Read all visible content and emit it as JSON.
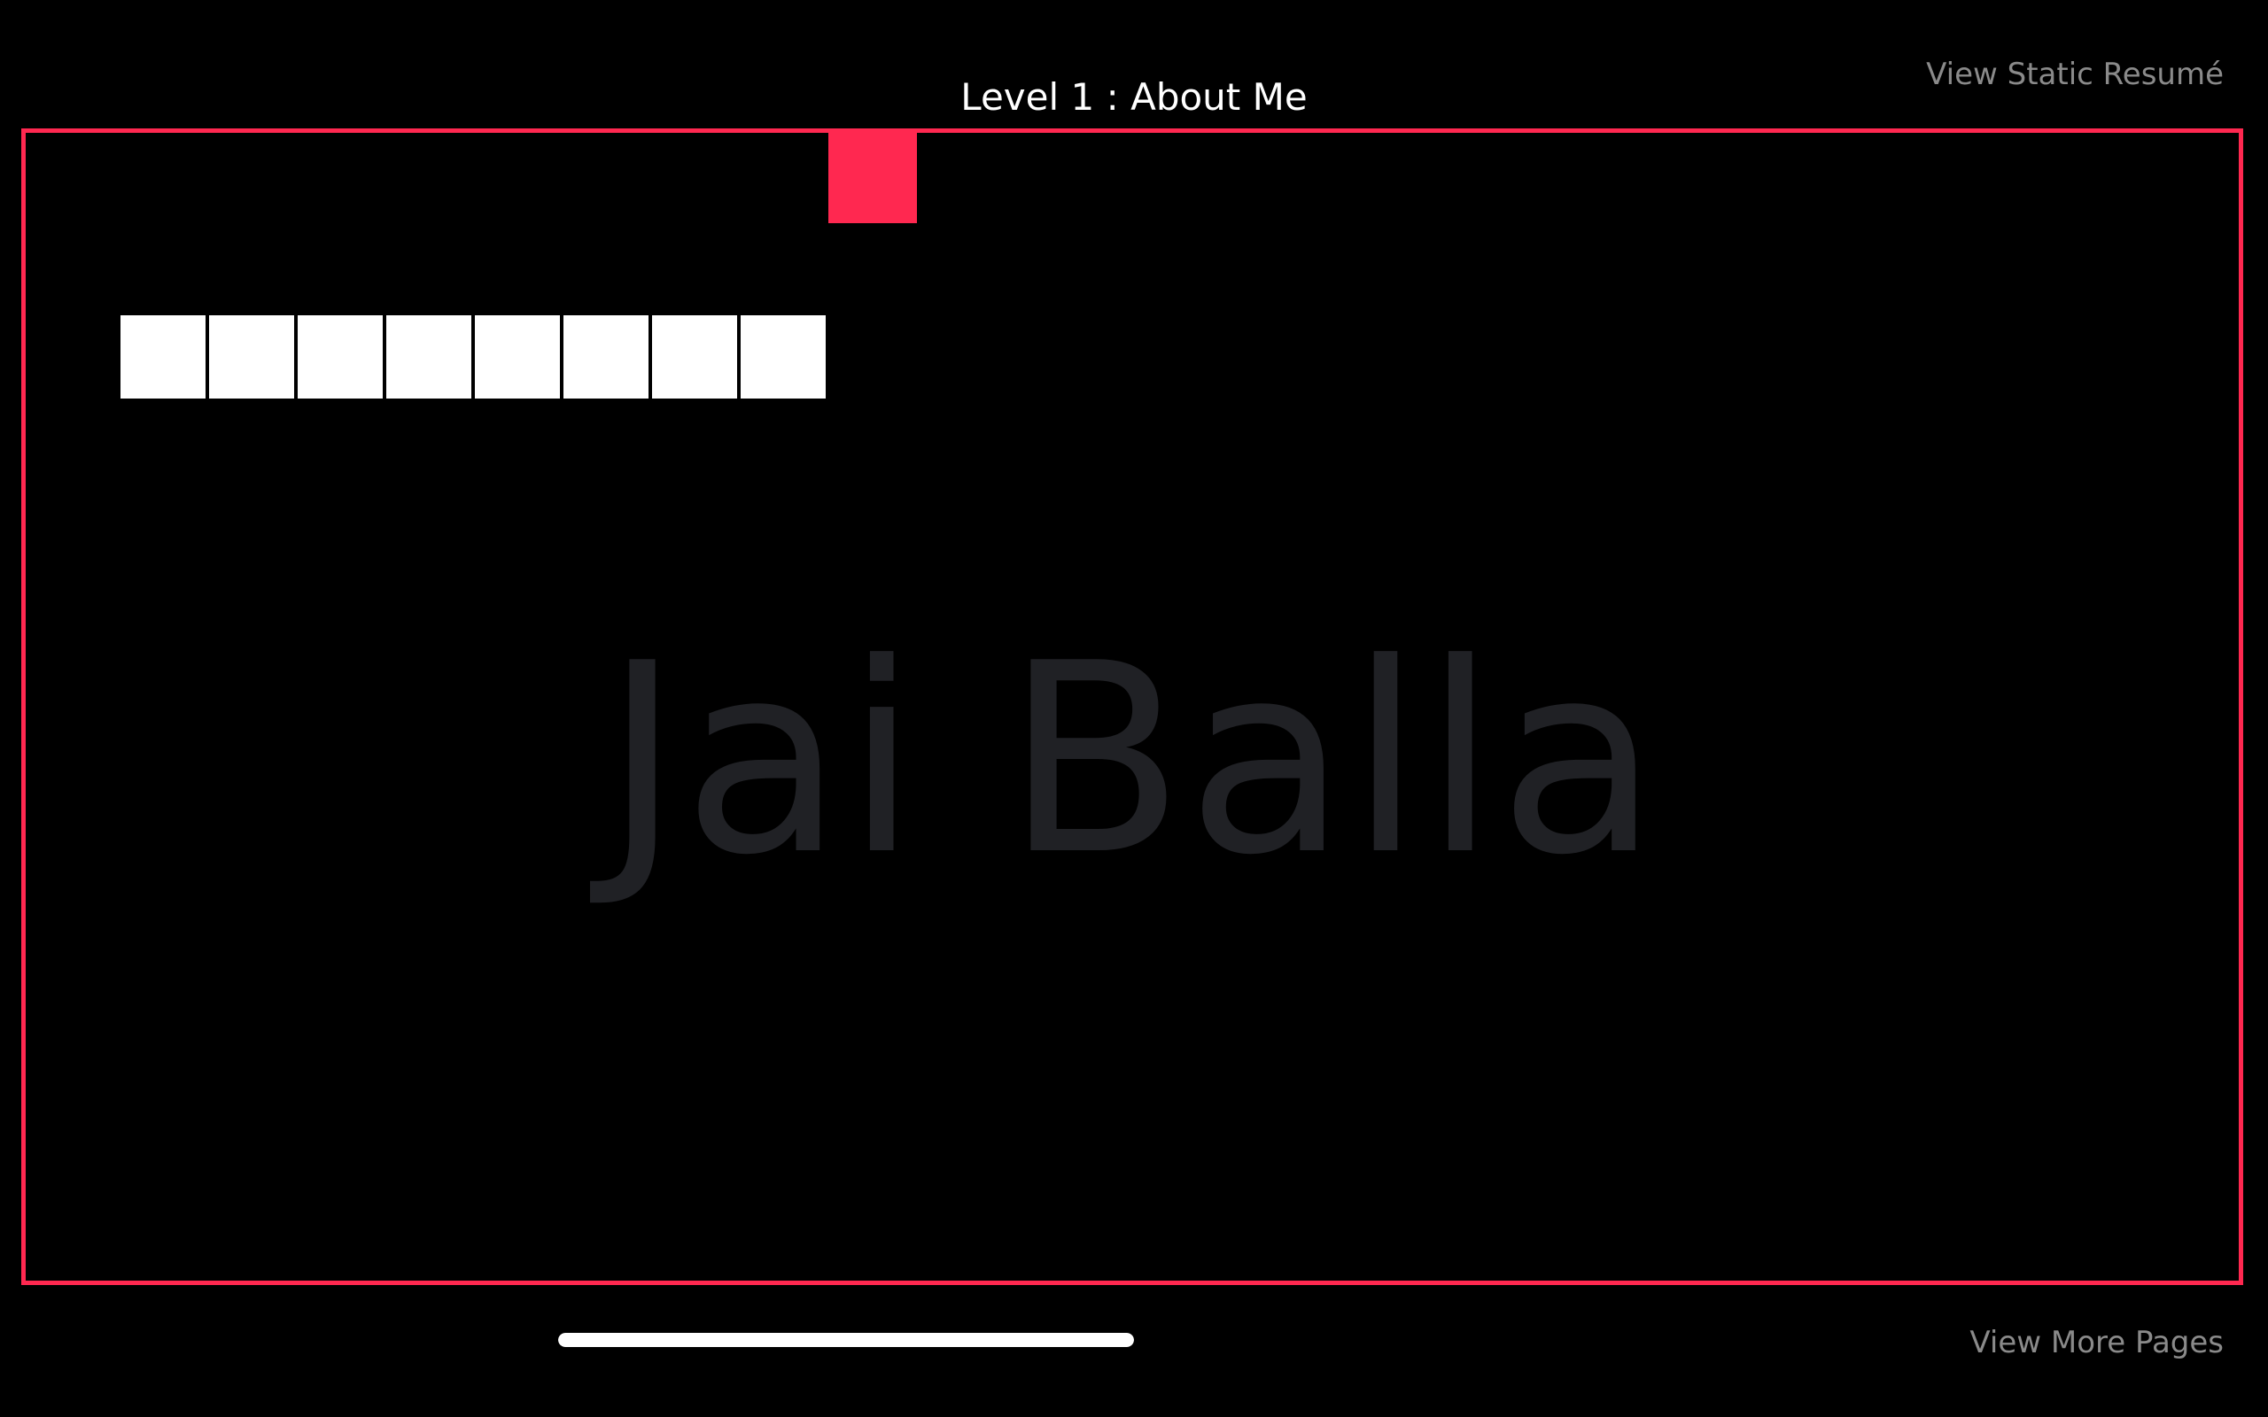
{
  "header": {
    "level_title": "Level 1 : About Me",
    "static_resume_link": "View Static Resumé"
  },
  "footer": {
    "more_pages_link": "View More Pages",
    "progress": 1.0
  },
  "game": {
    "background_name": "Jai Balla",
    "brick_count": 8,
    "colors": {
      "border": "#ff2850",
      "paddle": "#ff2850",
      "brick": "#ffffff",
      "background_text": "#202125"
    }
  }
}
